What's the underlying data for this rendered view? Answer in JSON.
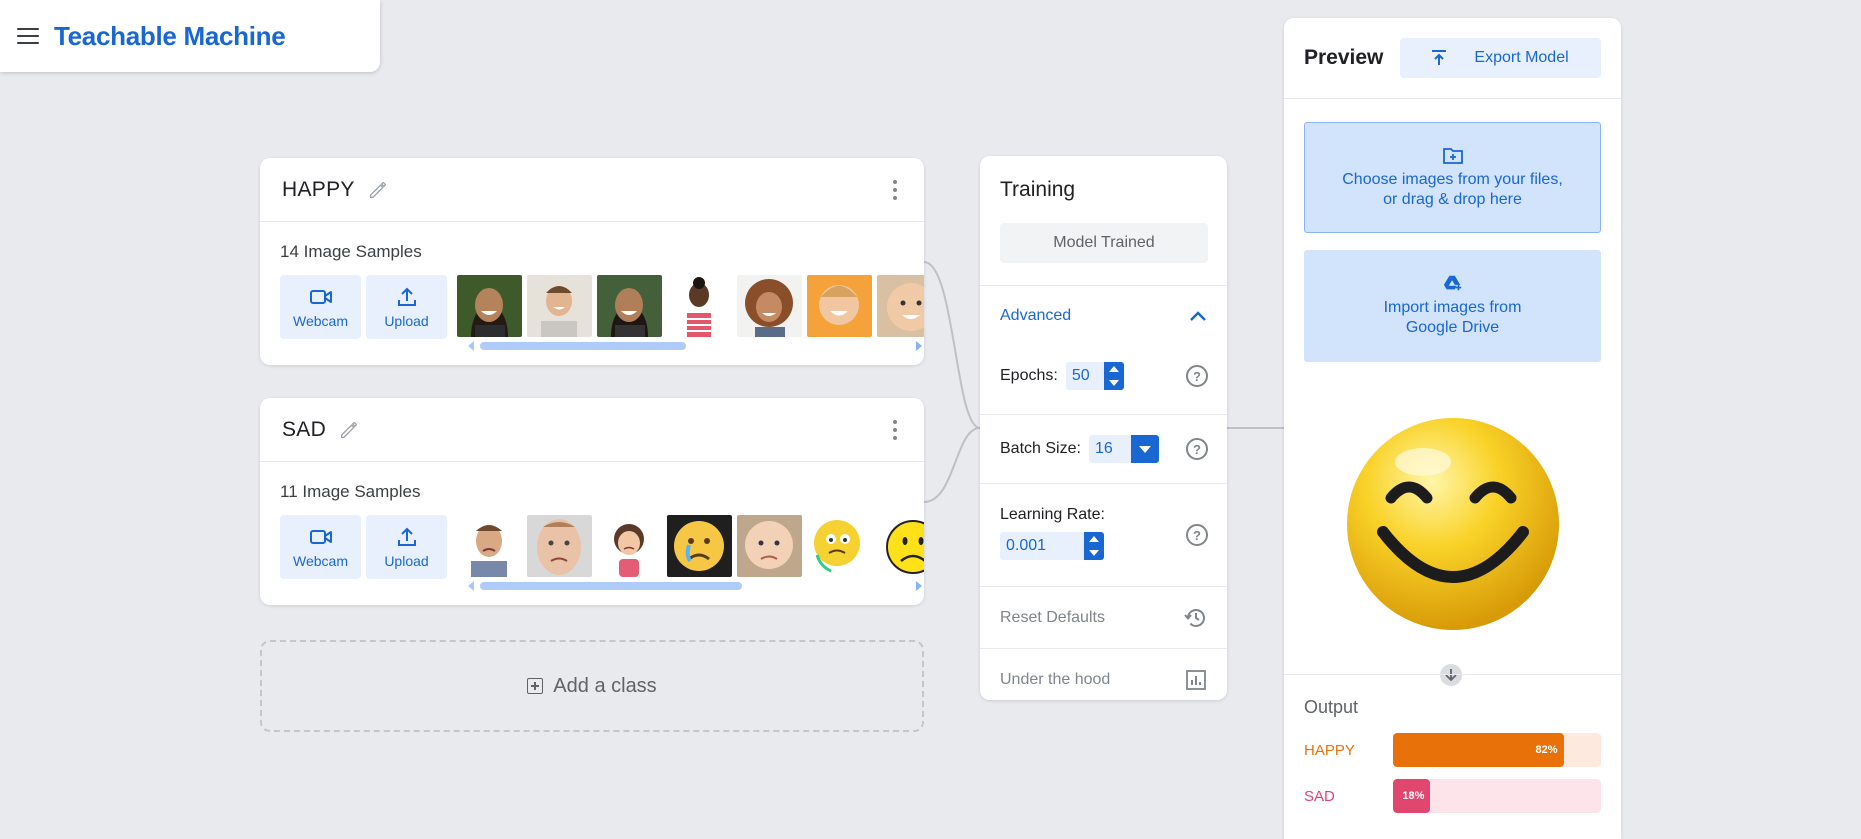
{
  "header": {
    "title": "Teachable Machine"
  },
  "classes": [
    {
      "name": "HAPPY",
      "sample_count": "14 Image Samples",
      "webcam_label": "Webcam",
      "upload_label": "Upload"
    },
    {
      "name": "SAD",
      "sample_count": "11 Image Samples",
      "webcam_label": "Webcam",
      "upload_label": "Upload"
    }
  ],
  "add_class": {
    "label": "Add a class"
  },
  "training": {
    "title": "Training",
    "button_label": "Model Trained",
    "advanced_label": "Advanced",
    "epochs_label": "Epochs:",
    "epochs_value": "50",
    "batch_size_label": "Batch Size:",
    "batch_size_value": "16",
    "learning_rate_label": "Learning Rate:",
    "learning_rate_value": "0.001",
    "help_glyph": "?",
    "reset_label": "Reset Defaults",
    "hood_label": "Under the hood"
  },
  "preview": {
    "title": "Preview",
    "export_label": "Export Model",
    "drop_line1": "Choose images from your files,",
    "drop_line2": "or drag & drop here",
    "drive_line1": "Import images from",
    "drive_line2": "Google Drive"
  },
  "output": {
    "title": "Output",
    "rows": [
      {
        "label": "HAPPY",
        "percent_text": "82%",
        "fraction": 0.82,
        "color": "#e8710a",
        "track": "#fde9dd"
      },
      {
        "label": "SAD",
        "percent_text": "18%",
        "fraction": 0.18,
        "color": "#e0466e",
        "track": "#fde4ea"
      }
    ]
  },
  "colors": {
    "accent": "#1967d2",
    "background": "#e8eaed"
  }
}
